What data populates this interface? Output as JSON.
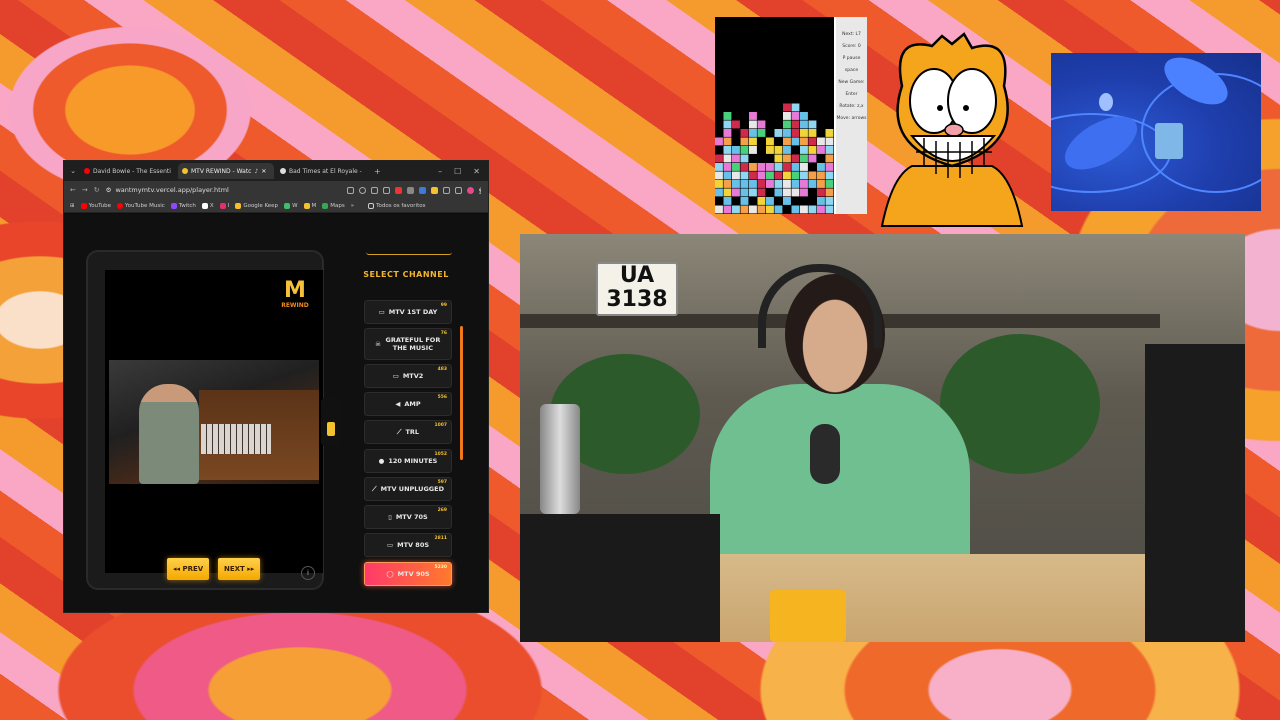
{
  "browser": {
    "tabs": [
      {
        "title": "David Bowie - The Essenti",
        "favicon_color": "#ff0000"
      },
      {
        "title": "MTV REWIND - Watc",
        "favicon_color": "#f3c22e",
        "active": true
      },
      {
        "title": "Bad Times at El Royale - ",
        "favicon_color": "#ffffff"
      }
    ],
    "url": "wantmymtv.vercel.app/player.html",
    "bookmarks": [
      {
        "label": "YouTube",
        "color": "#ff0000"
      },
      {
        "label": "YouTube Music",
        "color": "#ff0000"
      },
      {
        "label": "Twitch",
        "color": "#9146ff"
      },
      {
        "label": "X",
        "color": "#ffffff"
      },
      {
        "label": "I",
        "color": "#e1306c"
      },
      {
        "label": "Google Keep",
        "color": "#f6bf26"
      },
      {
        "label": "W",
        "color": "#39c26a"
      },
      {
        "label": "M",
        "color": "#f3c22e"
      },
      {
        "label": "Maps",
        "color": "#34a853"
      }
    ],
    "bookmarks_more": "»",
    "all_bookmarks": "Todos os favoritos"
  },
  "player": {
    "logo_text": "M",
    "logo_sub": "REWIND",
    "prev_label": "◂◂ PREV",
    "next_label": "NEXT ▸▸",
    "info_icon": "i"
  },
  "channels": {
    "title": "SELECT CHANNEL",
    "items": [
      {
        "icon": "▭",
        "label": "MTV 1ST DAY",
        "count": "99"
      },
      {
        "icon": "☠",
        "label": "GRATEFUL FOR THE MUSIC",
        "count": "76"
      },
      {
        "icon": "▭",
        "label": "MTV2",
        "count": "483"
      },
      {
        "icon": "◀",
        "label": "AMP",
        "count": "556"
      },
      {
        "icon": "⟋",
        "label": "TRL",
        "count": "1007"
      },
      {
        "icon": "●",
        "label": "120 MINUTES",
        "count": "1052"
      },
      {
        "icon": "⟋",
        "label": "MTV UNPLUGGED",
        "count": "597"
      },
      {
        "icon": "▯",
        "label": "MTV 70S",
        "count": "269"
      },
      {
        "icon": "▭",
        "label": "MTV 80S",
        "count": "2811"
      },
      {
        "icon": "◯",
        "label": "MTV 90S",
        "count": "5230",
        "active": true
      }
    ]
  },
  "tetris": {
    "side_labels": [
      "Next: L7",
      "Score: 0",
      "",
      "P pause space",
      "New Game: Enter",
      "Rotate: z,x",
      "Move: arrows"
    ]
  },
  "webcam": {
    "plate_line1": "UA",
    "plate_line2": "3138"
  },
  "colors": {
    "accent_yellow": "#f3c22e",
    "active_gradient_start": "#ff3a6a",
    "active_gradient_end": "#ff7a2a"
  }
}
